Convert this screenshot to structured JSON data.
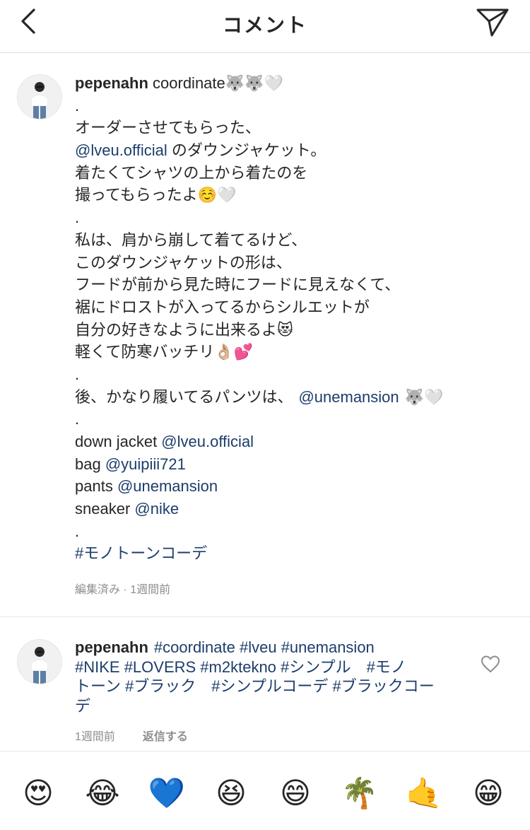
{
  "header": {
    "title": "コメント"
  },
  "caption": {
    "username": "pepenahn",
    "l1_text": " coordinate",
    "l1_emoji": "🐺🐺🤍",
    "dot": ".",
    "l2": "オーダーさせてもらった、",
    "l3_link": "@lveu.official",
    "l3_text": " のダウンジャケット。",
    "l4": "着たくてシャツの上から着たのを",
    "l5_text": "撮ってもらったよ",
    "l5_emoji": "☺️🤍",
    "l6": "私は、肩から崩して着てるけど、",
    "l7": "このダウンジャケットの形は、",
    "l8": "フードが前から見た時にフードに見えなくて、",
    "l9": "裾にドロストが入ってるからシルエットが",
    "l10_text": "自分の好きなように出来るよ",
    "l10_emoji": "😻",
    "l11_text": "軽くて防寒バッチリ",
    "l11_emoji": "👌🏼💕",
    "l12_text": "後、かなり履いてるパンツは、",
    "l12_link": "@unemansion",
    "l12_emoji": "🐺🤍",
    "l13_text": "down jacket ",
    "l13_link": "@lveu.official",
    "l14_text": "bag ",
    "l14_link": "@yuipiii721",
    "l15_text": "pants ",
    "l15_link": "@unemansion",
    "l16_text": "sneaker ",
    "l16_link": "@nike",
    "hashtag": "#モノトーンコーデ",
    "meta": "編集済み · 1週間前"
  },
  "reply": {
    "username": "pepenahn",
    "r1_tags": "#coordinate #lveu #unemansion",
    "r2_tags": "#NIKE #LOVERS  #m2ktekno #シンプル　#モノ",
    "r3_tags": "トーン #ブラック　#シンプルコーデ #ブラックコー",
    "r4_tags": "デ",
    "time": "1週間前",
    "reply_label": "返信する"
  },
  "emoji_bar": [
    "😍",
    "😂",
    "💙",
    "😆",
    "😄",
    "🌴",
    "🤙",
    "😁"
  ]
}
